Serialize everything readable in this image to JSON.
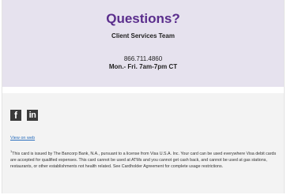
{
  "questions": {
    "title": "Questions?",
    "team": "Client Services Team",
    "phone": "866.711.4860",
    "hours": "Mon.- Fri. 7am-7pm CT"
  },
  "social": {
    "facebook_glyph": "f",
    "linkedin_glyph": "in"
  },
  "footer": {
    "view_on_web": "View on web",
    "disclaimer_marker": "1",
    "disclaimer": "This card is issued by The Bancorp Bank, N.A., pursuant to a license from Visa U.S.A. Inc. Your card can be used everywhere Visa debit cards are accepted for qualified expenses. This card cannot be used at ATMs and you cannot get cash back, and cannot be used at gas stations, restaurants, or other establishments not health related. See Cardholder Agreement for complete usage restrictions."
  },
  "colors": {
    "accent": "#5a2d8c",
    "header_bg": "#e6e2ee",
    "link": "#2a6ebd"
  },
  "icons": [
    "facebook-icon",
    "linkedin-icon"
  ]
}
